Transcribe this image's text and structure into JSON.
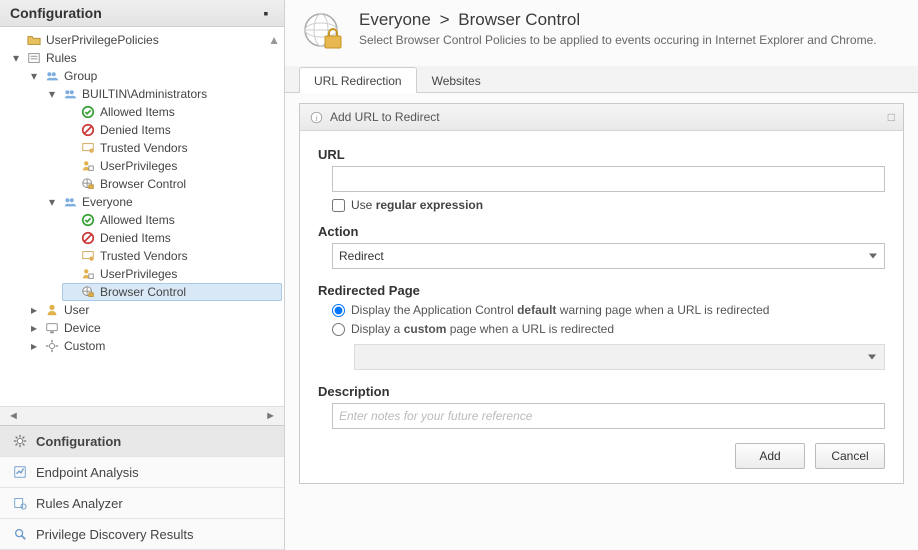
{
  "sidebar": {
    "title": "Configuration",
    "scroll_left": "◄",
    "scroll_right": "►",
    "collapse": "▪",
    "tree": {
      "user_priv_policies": "UserPrivilegePolicies",
      "rules": "Rules",
      "group": "Group",
      "builtin_admins": "BUILTIN\\Administrators",
      "allowed_items": "Allowed Items",
      "denied_items": "Denied Items",
      "trusted_vendors": "Trusted Vendors",
      "user_privileges": "UserPrivileges",
      "browser_control": "Browser Control",
      "everyone": "Everyone",
      "user": "User",
      "device": "Device",
      "custom": "Custom"
    },
    "nav": [
      "Configuration",
      "Endpoint Analysis",
      "Rules Analyzer",
      "Privilege Discovery Results"
    ]
  },
  "header": {
    "breadcrumb_left": "Everyone",
    "breadcrumb_sep": ">",
    "breadcrumb_right": "Browser Control",
    "subtitle": "Select Browser Control Policies to be applied to events occuring in Internet Explorer and Chrome."
  },
  "tabs": {
    "url_redirection": "URL Redirection",
    "websites": "Websites"
  },
  "panel": {
    "title": "Add URL to Redirect",
    "expand_hint": "□"
  },
  "form": {
    "url_label": "URL",
    "url_value": "",
    "regex_label": "Use regular expression",
    "action_label": "Action",
    "action_value": "Redirect",
    "redirected_label": "Redirected Page",
    "radio_default_pre": "Display the Application Control ",
    "radio_default_bold": "default",
    "radio_default_post": " warning page when a URL is redirected",
    "radio_custom_pre": "Display a ",
    "radio_custom_bold": "custom",
    "radio_custom_post": " page when a URL is redirected",
    "description_label": "Description",
    "description_placeholder": "Enter notes for your future reference",
    "btn_add": "Add",
    "btn_cancel": "Cancel"
  }
}
